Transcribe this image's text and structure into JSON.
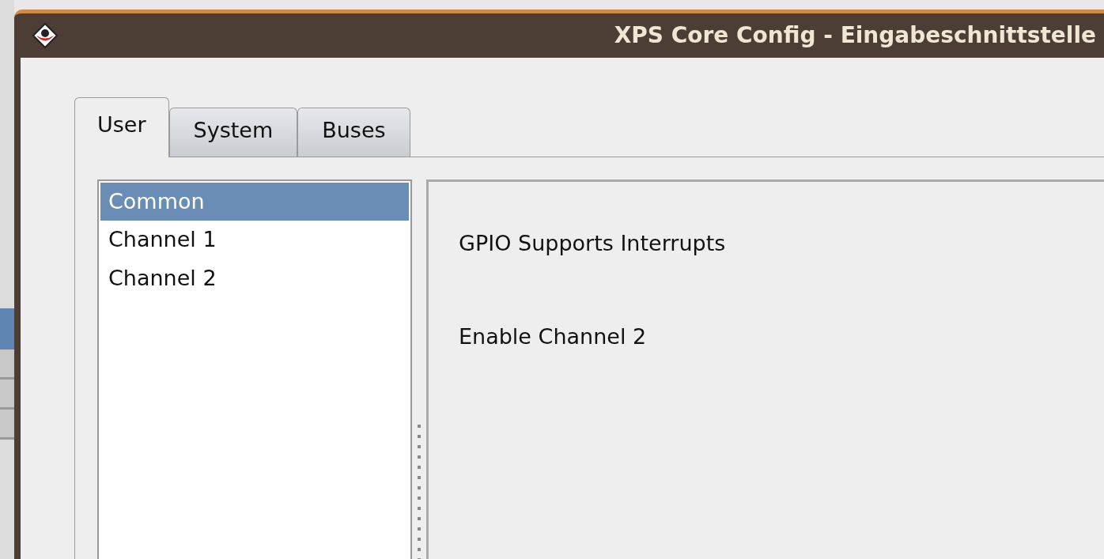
{
  "window": {
    "title": "XPS Core Config - Eingabeschnittstelle"
  },
  "tabs": [
    {
      "label": "User",
      "selected": true
    },
    {
      "label": "System",
      "selected": false
    },
    {
      "label": "Buses",
      "selected": false
    }
  ],
  "categories": [
    {
      "label": "Common",
      "selected": true
    },
    {
      "label": "Channel 1",
      "selected": false
    },
    {
      "label": "Channel 2",
      "selected": false
    }
  ],
  "parameters": [
    {
      "label": "GPIO Supports Interrupts"
    },
    {
      "label": "Enable Channel 2"
    }
  ]
}
